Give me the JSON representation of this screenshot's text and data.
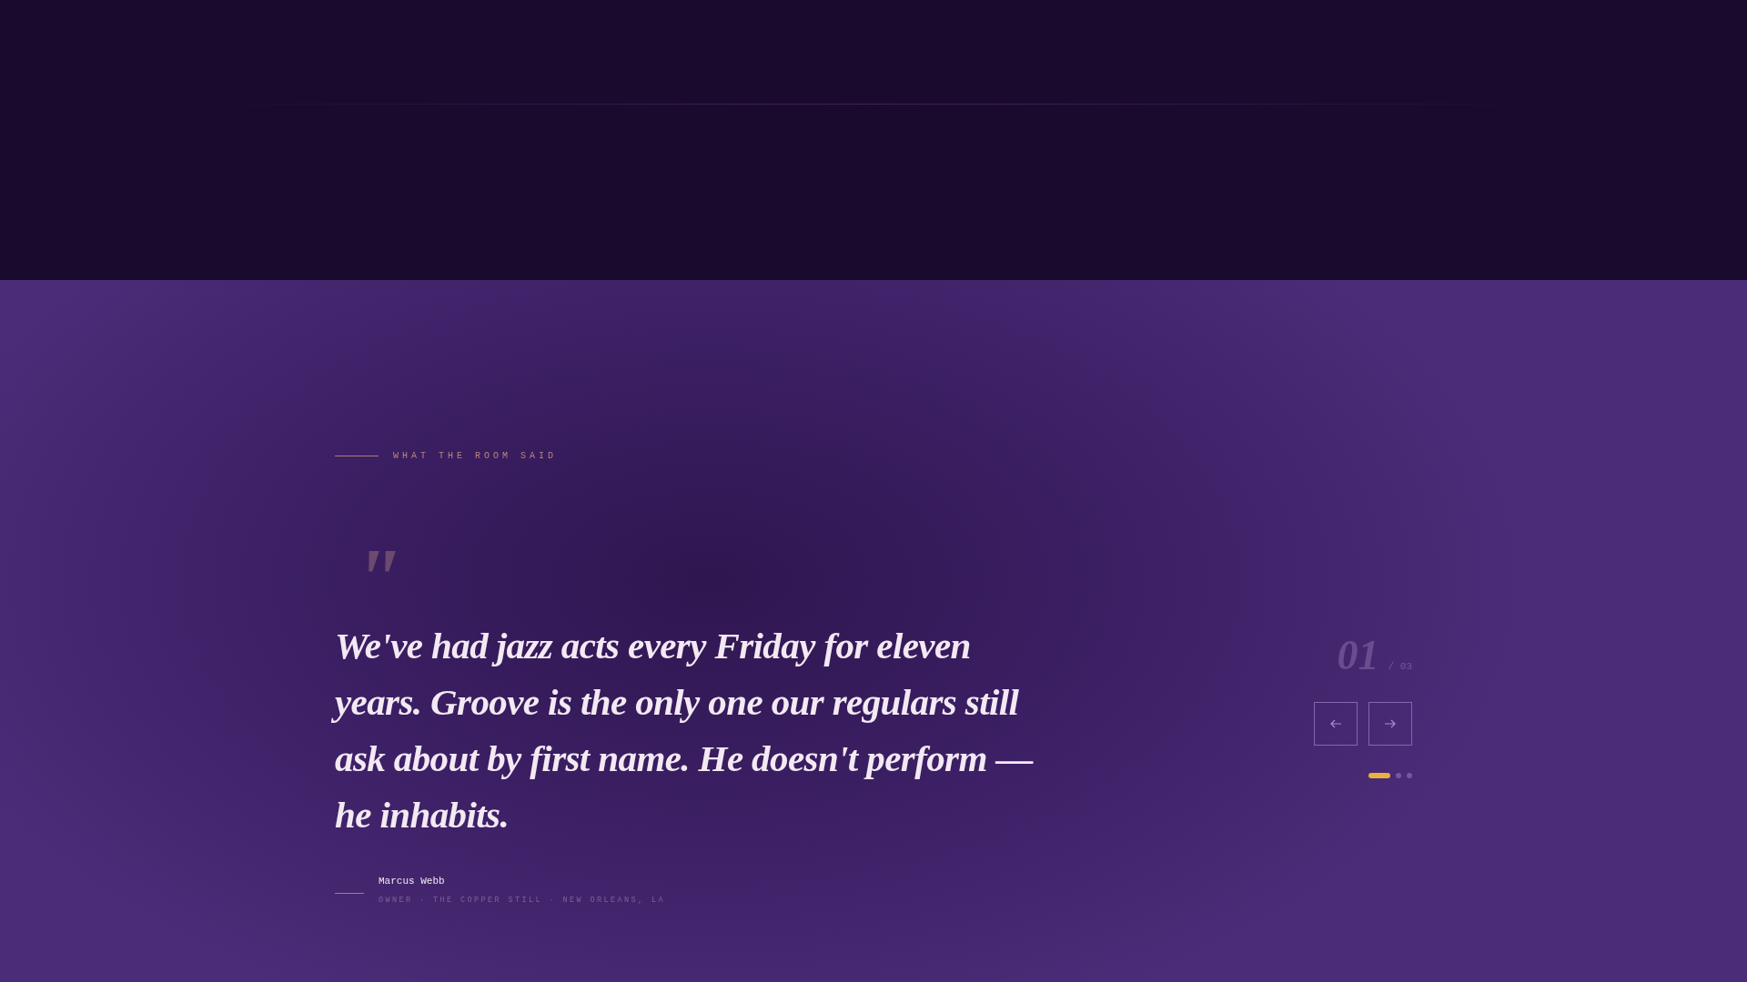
{
  "eyebrow": "WHAT THE ROOM SAID",
  "quote_mark": "\"",
  "quote": "We've had jazz acts every Friday for eleven years. Groove is the only one our regulars still ask about by first name. He doesn't perform — he inhabits.",
  "author": {
    "name": "Marcus Webb",
    "role": "OWNER · THE COPPER STILL · NEW ORLEANS, LA"
  },
  "counter": {
    "current": "01",
    "total": "/ 03"
  },
  "buttons": [
    {
      "kind": "prev"
    },
    {
      "kind": "next"
    }
  ],
  "dots": [
    {
      "selected": true
    },
    {
      "selected": false
    },
    {
      "selected": false
    }
  ]
}
